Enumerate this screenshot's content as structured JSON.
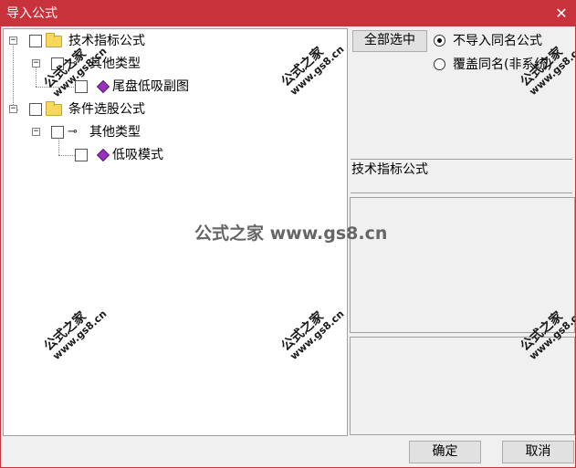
{
  "dialog": {
    "title": "导入公式",
    "close_glyph": "✕"
  },
  "tree": {
    "nodes": [
      {
        "label": "技术指标公式",
        "expander": "−"
      },
      {
        "label": "其他类型",
        "expander": "−"
      },
      {
        "label": "尾盘低吸副图"
      },
      {
        "label": "条件选股公式",
        "expander": "−"
      },
      {
        "label": "其他类型",
        "expander": "−"
      },
      {
        "label": "低吸模式"
      }
    ]
  },
  "toolbar": {
    "select_all_label": "全部选中",
    "radio_skip_label": "不导入同名公式",
    "radio_overwrite_label": "覆盖同名(非系统)"
  },
  "info": {
    "selected_type_label": "技术指标公式"
  },
  "footer": {
    "ok_label": "确定",
    "cancel_label": "取消"
  },
  "watermark": {
    "center": "公式之家 www.gs8.cn",
    "stamp_cn": "公式之家",
    "stamp_url": "www.gs8.cn"
  },
  "icons": {
    "folder": "folder-icon",
    "key": "key-icon",
    "formula": "formula-gem-icon"
  },
  "colors": {
    "titlebar": "#c8333b",
    "folder": "#f6d85a",
    "gem": "#9b2fbf"
  }
}
